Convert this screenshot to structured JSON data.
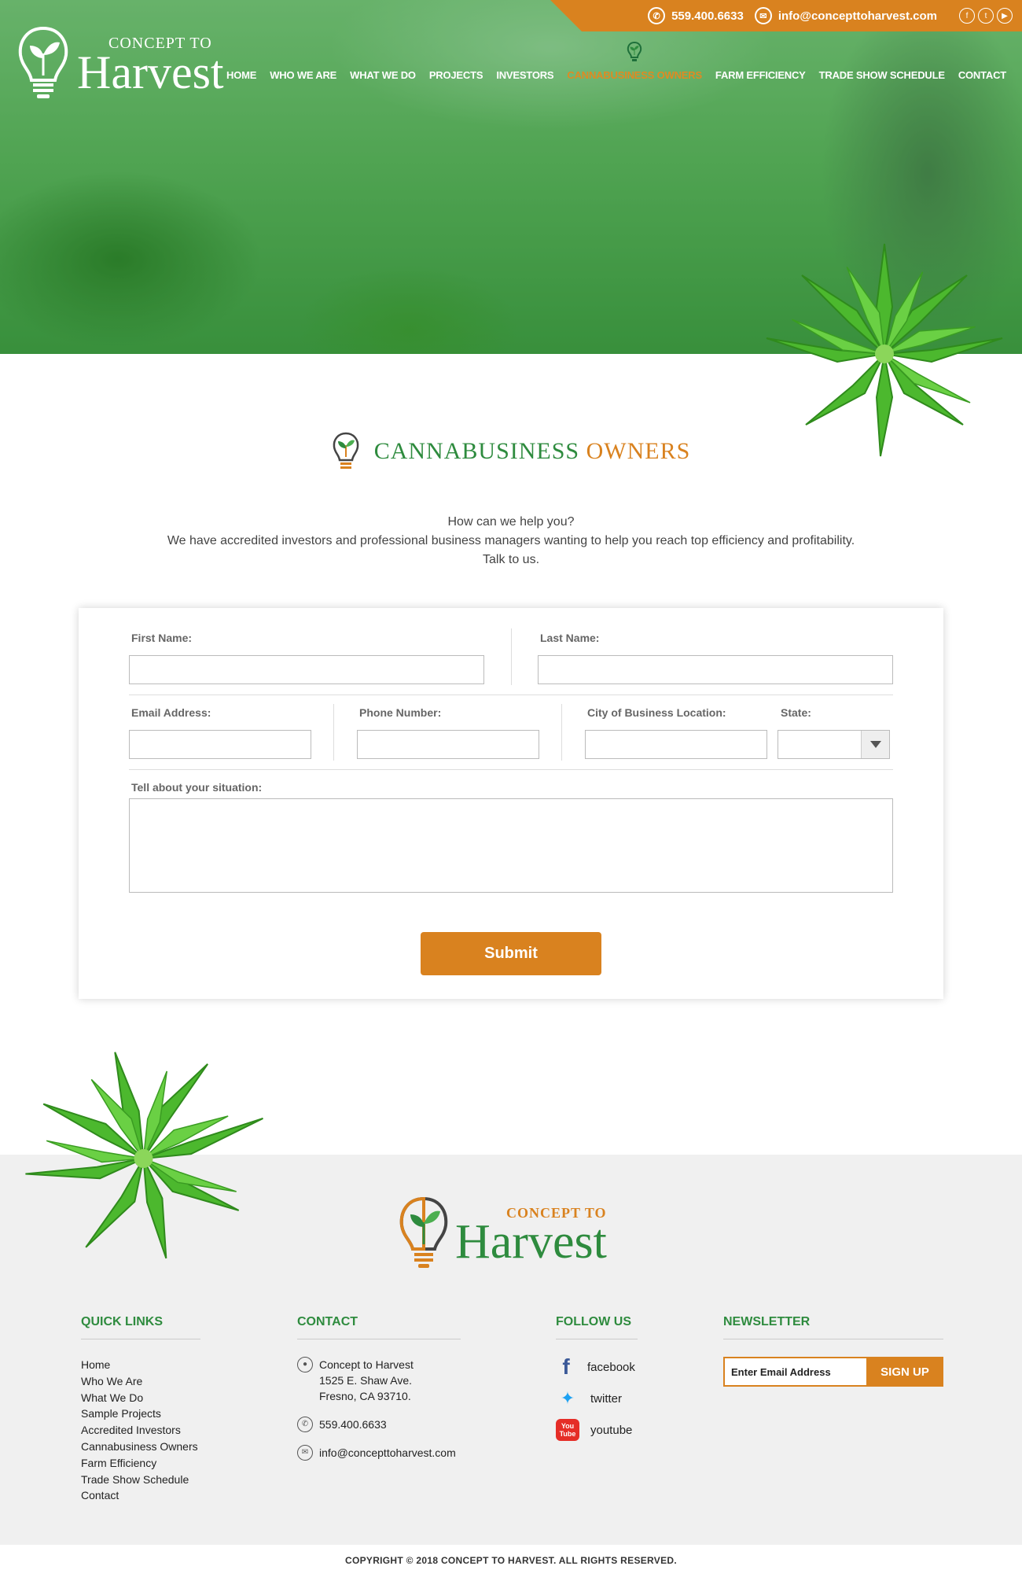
{
  "topbar": {
    "phone": "559.400.6633",
    "email": "info@concepttoharvest.com",
    "social_icons": [
      "facebook-icon",
      "twitter-icon",
      "youtube-icon"
    ]
  },
  "brand": {
    "small": "CONCEPT TO",
    "big": "Harvest"
  },
  "nav": {
    "items": [
      "HOME",
      "WHO WE ARE",
      "WHAT WE DO",
      "PROJECTS",
      "INVESTORS",
      "CANNABUSINESS OWNERS",
      "FARM EFFICIENCY",
      "TRADE SHOW SCHEDULE",
      "CONTACT"
    ],
    "active_index": 5
  },
  "page": {
    "title_green": "CANNABUSINESS",
    "title_orange": "OWNERS",
    "intro_line1": "How can we help you?",
    "intro_line2": "We have accredited investors and professional business managers wanting to help you reach top efficiency and profitability.",
    "intro_line3": "Talk to us."
  },
  "form": {
    "first_name_label": "First Name:",
    "last_name_label": "Last Name:",
    "email_label": "Email Address:",
    "phone_label": "Phone Number:",
    "city_label": "City of Business Location:",
    "state_label": "State:",
    "situation_label": "Tell about your situation:",
    "submit_label": "Submit"
  },
  "footer": {
    "quick_links_title": "QUICK LINKS",
    "quick_links": [
      "Home",
      "Who We Are",
      "What We Do",
      "Sample Projects",
      "Accredited Investors",
      "Cannabusiness Owners",
      "Farm Efficiency",
      "Trade Show Schedule",
      "Contact"
    ],
    "contact_title": "CONTACT",
    "address_line1": "Concept to Harvest",
    "address_line2": "1525 E. Shaw Ave.",
    "address_line3": "Fresno, CA 93710.",
    "phone": "559.400.6633",
    "email": "info@concepttoharvest.com",
    "follow_title": "FOLLOW US",
    "facebook": "facebook",
    "twitter": "twitter",
    "youtube": "youtube",
    "youtube_badge_line1": "You",
    "youtube_badge_line2": "Tube",
    "newsletter_title": "NEWSLETTER",
    "newsletter_placeholder": "Enter Email Address",
    "signup_label": "SIGN UP",
    "copyright": "COPYRIGHT © 2018 CONCEPT TO HARVEST. ALL RIGHTS RESERVED."
  },
  "colors": {
    "brand_green": "#2e8b3e",
    "brand_orange": "#d9821f",
    "footer_bg": "#f0f0f0"
  }
}
